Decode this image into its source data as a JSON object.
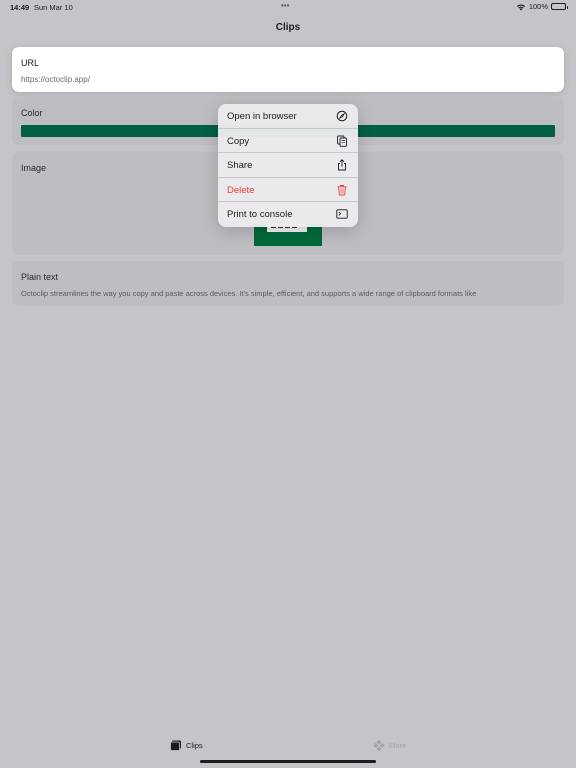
{
  "status": {
    "time": "14:49",
    "date": "Sun Mar 10",
    "dots": "•••",
    "battery": "100%"
  },
  "nav": {
    "title": "Clips"
  },
  "clips": {
    "url": {
      "title": "URL",
      "value": "https://octoclip.app/"
    },
    "color": {
      "title": "Color",
      "swatch": "#005f45"
    },
    "image": {
      "title": "Image"
    },
    "plain": {
      "title": "Plain text",
      "value": "Octoclip streamlines the way you copy and paste across devices. It's simple, efficient, and supports a wide range of clipboard formats like"
    }
  },
  "context_menu": {
    "items": [
      {
        "label": "Open in browser",
        "icon": "compass-icon"
      },
      {
        "label": "Copy",
        "icon": "copy-icon"
      },
      {
        "label": "Share",
        "icon": "share-icon"
      },
      {
        "label": "Delete",
        "icon": "trash-icon",
        "destructive": true
      },
      {
        "label": "Print to console",
        "icon": "terminal-icon"
      }
    ]
  },
  "tabs": [
    {
      "label": "Clips",
      "icon": "clips-icon",
      "selected": true
    },
    {
      "label": "More",
      "icon": "more-icon",
      "selected": false
    }
  ],
  "colors": {
    "destructive": "#ec4036",
    "accent": "#005f45",
    "background": "#c5c4c9"
  }
}
